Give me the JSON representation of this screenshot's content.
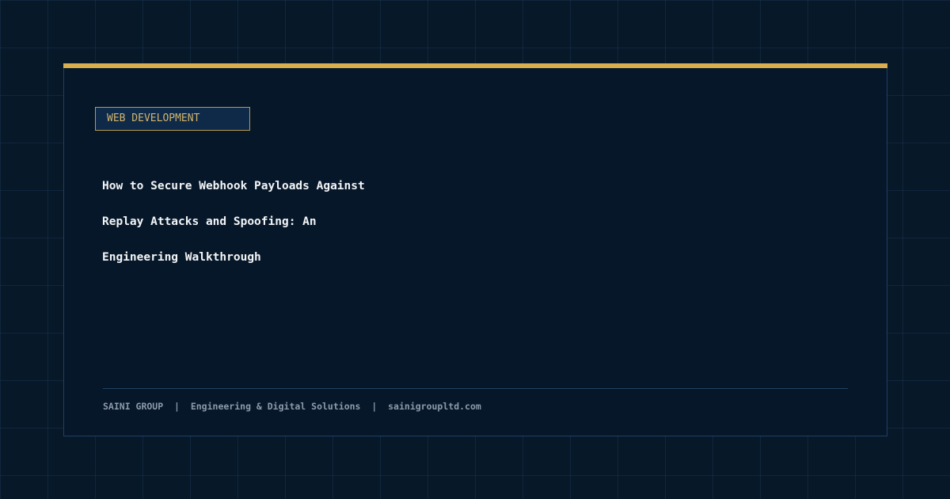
{
  "card": {
    "category": "WEB DEVELOPMENT",
    "title_lines": [
      "How to Secure Webhook Payloads Against",
      "Replay Attacks and Spoofing: An",
      "Engineering Walkthrough"
    ]
  },
  "footer": {
    "company": "SAINI GROUP",
    "separator": "|",
    "tagline": "Engineering & Digital Solutions",
    "website": "sainigroupltd.com"
  },
  "colors": {
    "background": "#071829",
    "card_background": "#061729",
    "accent": "#d9ae4e",
    "badge_text": "#d2b46c",
    "title_text": "#f3f5f7",
    "footer_text": "#8d9bab"
  }
}
